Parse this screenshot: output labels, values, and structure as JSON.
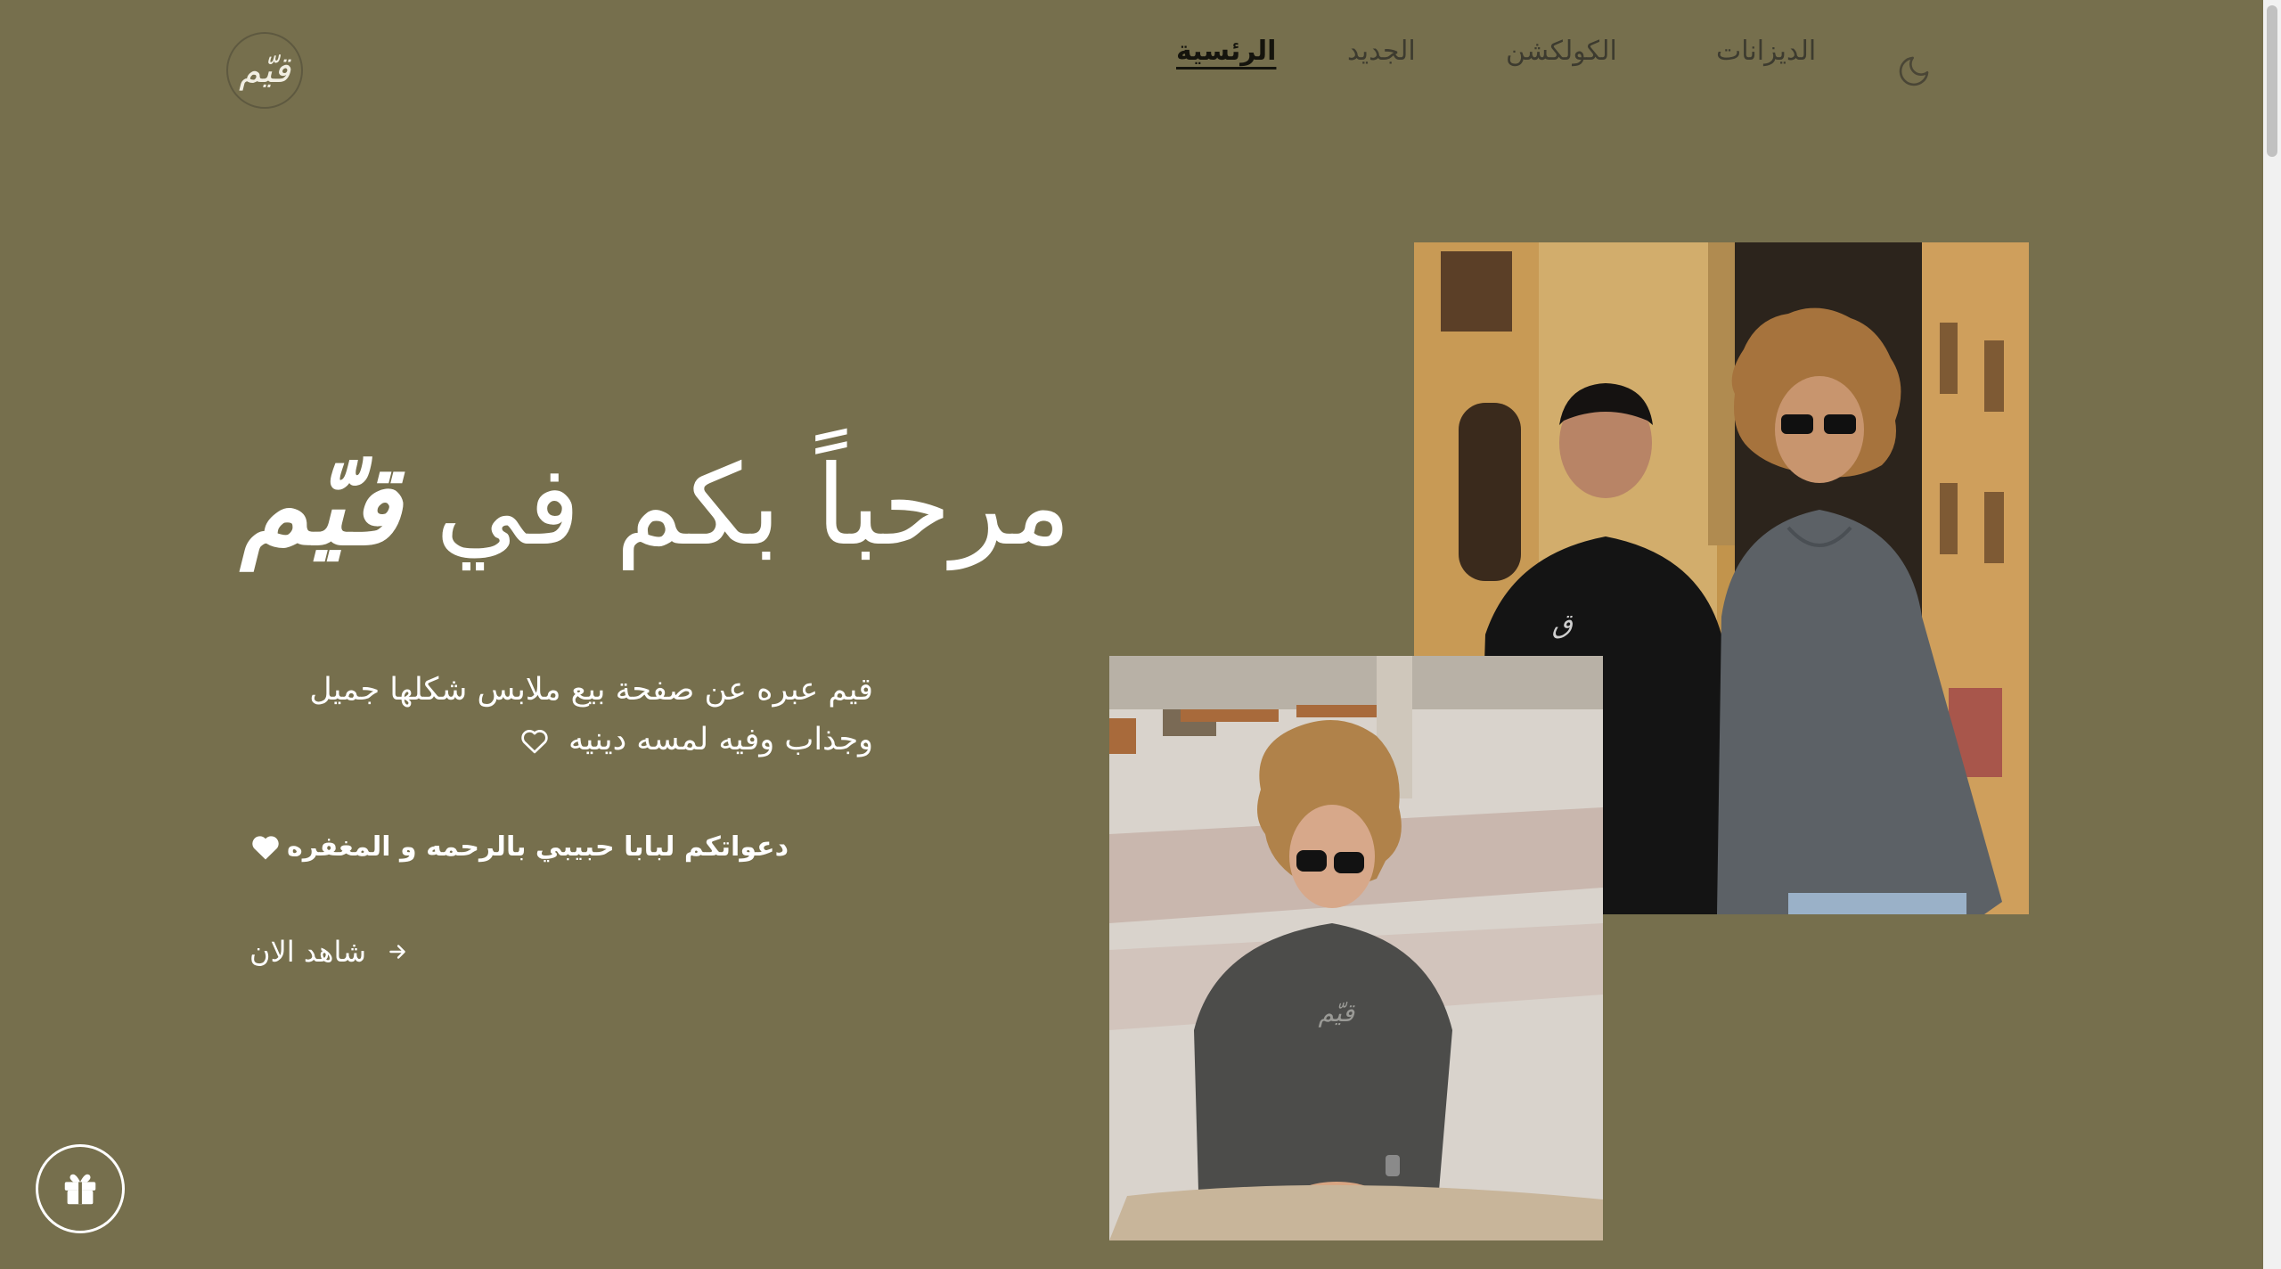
{
  "colors": {
    "background": "#766f4d",
    "text_light": "#ffffff",
    "nav_text": "#3d3b2f",
    "nav_active": "#15140d"
  },
  "logo": {
    "label": "قيّم"
  },
  "nav": {
    "items": [
      {
        "label": "الرئسية",
        "active": true
      },
      {
        "label": "الجديد",
        "active": false
      },
      {
        "label": "الكولكشن",
        "active": false
      },
      {
        "label": "الديزانات",
        "active": false
      }
    ],
    "theme_icon": "moon-icon"
  },
  "hero": {
    "title_prefix": "مرحباً بكم في",
    "title_brand": "قيّم",
    "desc_line1": "قيم عبره عن صفحة بيع ملابس شكلها جميل",
    "desc_line2": "وجذاب وفيه لمسه دينيه",
    "prayer": "دعواتكم لبابا حبيبي بالرحمه و المغفره",
    "cta_label": "شاهد الان",
    "cta_icon": "arrow-right-icon"
  },
  "images": {
    "main_alt": "two-men-in-hoodies-photo",
    "secondary_alt": "man-in-grey-hoodie-photo"
  },
  "gift_button_icon": "gift-icon"
}
